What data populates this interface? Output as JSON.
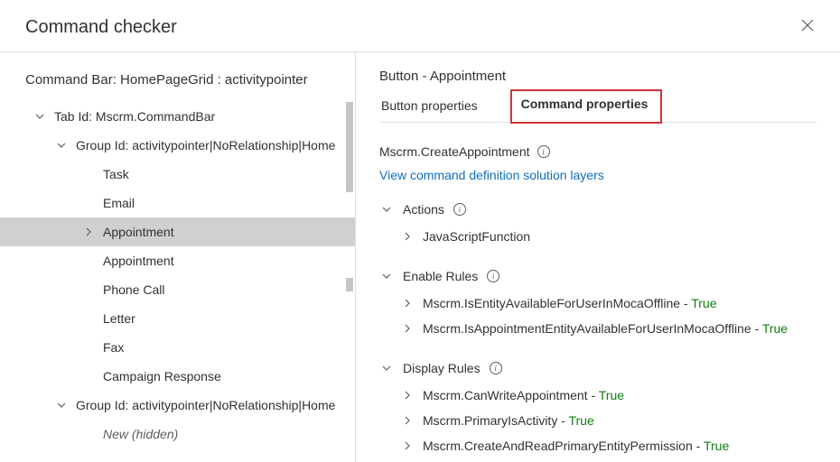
{
  "header": {
    "title": "Command checker"
  },
  "left": {
    "title": "Command Bar: HomePageGrid : activitypointer",
    "tree": {
      "tab_label": "Tab Id: Mscrm.CommandBar",
      "group1_label": "Group Id: activitypointer|NoRelationship|Home",
      "group1_items": [
        "Task",
        "Email",
        "Appointment",
        "Appointment",
        "Phone Call",
        "Letter",
        "Fax",
        "Campaign Response"
      ],
      "group2_label": "Group Id: activitypointer|NoRelationship|Home",
      "group2_items": [
        "New (hidden)"
      ]
    }
  },
  "right": {
    "title": "Button - Appointment",
    "tabs": {
      "button_properties": "Button properties",
      "command_properties": "Command properties"
    },
    "command_name": "Mscrm.CreateAppointment",
    "link_text": "View command definition solution layers",
    "sections": {
      "actions": {
        "label": "Actions",
        "items": [
          "JavaScriptFunction"
        ]
      },
      "enable_rules": {
        "label": "Enable Rules",
        "rules": [
          {
            "name": "Mscrm.IsEntityAvailableForUserInMocaOffline",
            "value": "True"
          },
          {
            "name": "Mscrm.IsAppointmentEntityAvailableForUserInMocaOffline",
            "value": "True"
          }
        ]
      },
      "display_rules": {
        "label": "Display Rules",
        "rules": [
          {
            "name": "Mscrm.CanWriteAppointment",
            "value": "True"
          },
          {
            "name": "Mscrm.PrimaryIsActivity",
            "value": "True"
          },
          {
            "name": "Mscrm.CreateAndReadPrimaryEntityPermission",
            "value": "True"
          }
        ]
      }
    }
  }
}
